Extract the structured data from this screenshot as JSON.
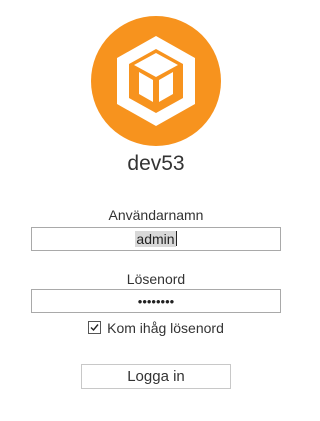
{
  "app": {
    "hostname": "dev53",
    "brand_color": "#f7931e",
    "logo_icon": "cube-logo-icon"
  },
  "login_form": {
    "username_label": "Användarnamn",
    "username_value": "admin",
    "password_label": "Lösenord",
    "password_value": "••••••••",
    "remember_label": "Kom ihåg lösenord",
    "remember_checked": true,
    "submit_label": "Logga in"
  }
}
